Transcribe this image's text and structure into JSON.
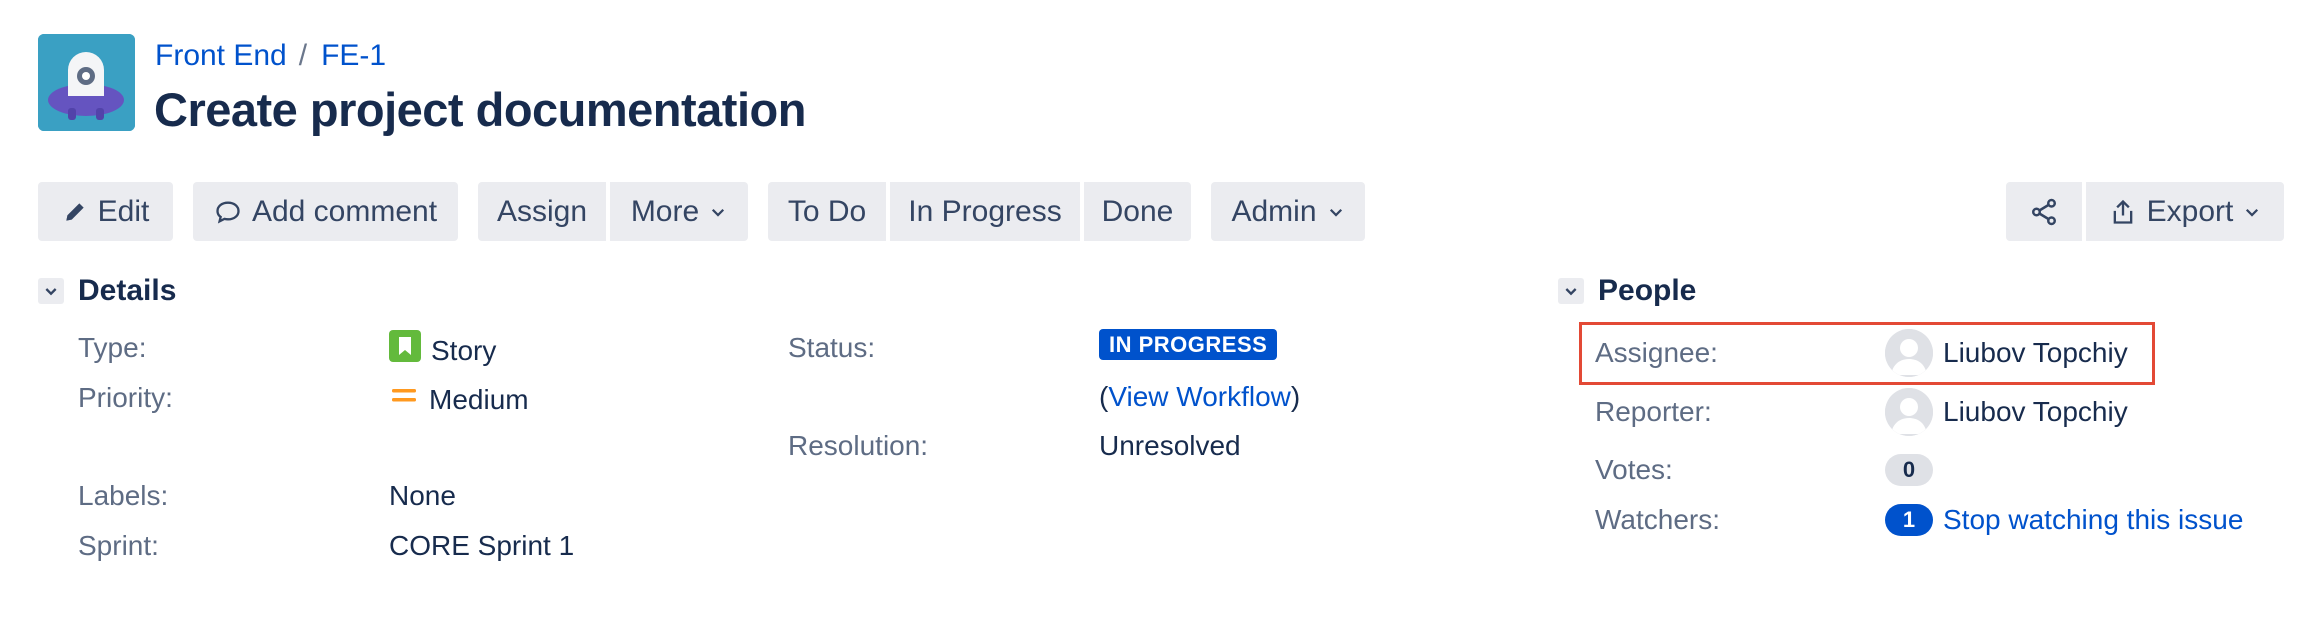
{
  "breadcrumb": {
    "project": "Front End",
    "separator": "/",
    "issue_key": "FE-1"
  },
  "issue": {
    "title": "Create project documentation"
  },
  "toolbar": {
    "edit": "Edit",
    "add_comment": "Add comment",
    "assign": "Assign",
    "more": "More",
    "to_do": "To Do",
    "in_progress": "In Progress",
    "done": "Done",
    "admin": "Admin",
    "export": "Export"
  },
  "details": {
    "heading": "Details",
    "type_label": "Type:",
    "type_value": "Story",
    "priority_label": "Priority:",
    "priority_value": "Medium",
    "labels_label": "Labels:",
    "labels_value": "None",
    "sprint_label": "Sprint:",
    "sprint_value": "CORE Sprint 1",
    "status_label": "Status:",
    "status_value": "IN PROGRESS",
    "workflow_open": "(",
    "workflow_link": "View Workflow",
    "workflow_close": ")",
    "resolution_label": "Resolution:",
    "resolution_value": "Unresolved"
  },
  "people": {
    "heading": "People",
    "assignee_label": "Assignee:",
    "assignee_value": "Liubov Topchiy",
    "reporter_label": "Reporter:",
    "reporter_value": "Liubov Topchiy",
    "votes_label": "Votes:",
    "votes_value": "0",
    "watchers_label": "Watchers:",
    "watchers_value": "1",
    "watch_link": "Stop watching this issue"
  },
  "colors": {
    "link": "#0052cc",
    "status_in_progress": "#0052cc",
    "story_icon": "#63ba3c",
    "priority_medium": "#ff991f",
    "highlight": "#e34935"
  },
  "icons": {
    "project_avatar": "project-avatar-icon",
    "edit": "pencil-icon",
    "comment": "comment-icon",
    "dropdown": "chevron-down-icon",
    "share": "share-icon",
    "export": "export-icon",
    "story": "story-icon",
    "priority": "priority-medium-icon",
    "collapse": "chevron-down-icon",
    "user": "user-avatar-icon"
  }
}
